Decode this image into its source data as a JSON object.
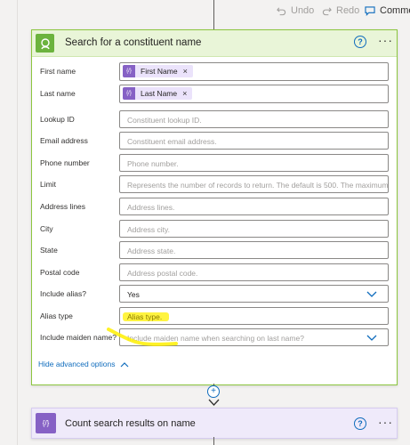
{
  "toolbar": {
    "undo_label": "Undo",
    "redo_label": "Redo",
    "comment_label": "Comme"
  },
  "card": {
    "title": "Search for a constituent name",
    "help": "?",
    "more": "···",
    "rows": [
      {
        "label": "First name",
        "token": "First Name",
        "token_fx": "{/}",
        "token_x": "×"
      },
      {
        "label": "Last name",
        "token": "Last Name",
        "token_fx": "{/}",
        "token_x": "×"
      },
      {
        "label": "Lookup ID",
        "placeholder": "Constituent lookup ID."
      },
      {
        "label": "Email address",
        "placeholder": "Constituent email address."
      },
      {
        "label": "Phone number",
        "placeholder": "Phone number."
      },
      {
        "label": "Limit",
        "placeholder": "Represents the number of records to return. The default is 500. The maximum i"
      },
      {
        "label": "Address lines",
        "placeholder": "Address lines."
      },
      {
        "label": "City",
        "placeholder": "Address city."
      },
      {
        "label": "State",
        "placeholder": "Address state."
      },
      {
        "label": "Postal code",
        "placeholder": "Address postal code."
      },
      {
        "label": "Include alias?",
        "value": "Yes"
      },
      {
        "label": "Alias type",
        "placeholder": "Alias type."
      },
      {
        "label": "Include maiden name?",
        "placeholder": "Include maiden name when searching on last name?"
      }
    ],
    "hide_advanced": "Hide advanced options"
  },
  "connector": {
    "plus": "+"
  },
  "next_card": {
    "title": "Count search results on name",
    "icon_text": "{/}",
    "help": "?",
    "more": "···"
  },
  "colors": {
    "accent": "#0f6cbd",
    "card_header": "#e9f5d8",
    "card_icon": "#6cb33e",
    "variable_token": "#8661c5",
    "highlight": "#fff000"
  }
}
